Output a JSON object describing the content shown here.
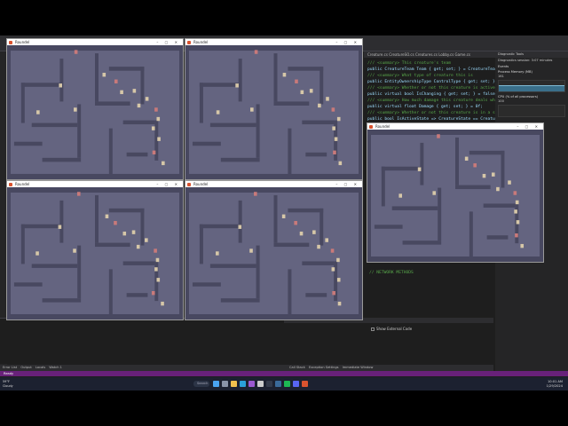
{
  "ide": {
    "tab_label": "Creature.cs  CreatureSO.cs  Creatures.cs  Lobby.cs  Game.cs",
    "code_lines": [
      {
        "text": "/// <summary> This creature's team",
        "type": "comment"
      },
      {
        "text": "public CreatureTeam Team { get; set; } = CreatureTeam.Neutral;",
        "type": "code"
      },
      {
        "text": "/// <summary> What type of creature this is",
        "type": "comment"
      },
      {
        "text": "public EntityOwnershipType ControlType { get; set; } = EntityO",
        "type": "code"
      },
      {
        "text": "/// <summary> Whether or not this creature is actively deali",
        "type": "comment"
      },
      {
        "text": "public virtual bool IsChanging { get; set; } = false;",
        "type": "code"
      },
      {
        "text": "/// <summary> How much damage this creature deals when attac",
        "type": "comment"
      },
      {
        "text": "public virtual float Damage { get; set; } = 0f;",
        "type": "code"
      },
      {
        "text": "/// <summary> Whether or not this creature is in a state tha",
        "type": "comment"
      },
      {
        "text": "public bool IsActiveState => CreatureState == CreatureState.",
        "type": "code"
      }
    ],
    "network_comment": "// NETWORK METHODS",
    "show_external_code": "Show External Code",
    "bottom_tabs_left": [
      "Error List",
      "Output",
      "Locals",
      "Watch 1"
    ],
    "bottom_tabs_right": [
      "Call Stack",
      "Exception Settings",
      "Immediate Window"
    ],
    "status_text": "Ready"
  },
  "diagnostics": {
    "title": "Diagnostic Tools",
    "session": "Diagnostics session: 3:07 minutes",
    "events_label": "Events",
    "memory_label": "Process Memory (MB)",
    "memory_value": "161",
    "cpu_label": "CPU (% of all processors)",
    "cpu_value": "100"
  },
  "game_windows": [
    {
      "title": "Roundel",
      "id": "1"
    },
    {
      "title": "Roundel",
      "id": "2"
    },
    {
      "title": "Roundel",
      "id": "3"
    },
    {
      "title": "Roundel",
      "id": "4"
    },
    {
      "title": "Roundel",
      "id": "5"
    }
  ],
  "taskbar": {
    "weather_temp": "59°F",
    "weather_desc": "Cloudy",
    "search_label": "Search",
    "time": "10:01 AM",
    "date": "1/29/2024",
    "app_icons": [
      {
        "name": "start-icon",
        "color": "#4aa3f0"
      },
      {
        "name": "task-view-icon",
        "color": "#8a94a8"
      },
      {
        "name": "file-explorer-icon",
        "color": "#f2c14e"
      },
      {
        "name": "edge-icon",
        "color": "#2aa0d8"
      },
      {
        "name": "visual-studio-icon",
        "color": "#9b59d0"
      },
      {
        "name": "unity-icon",
        "color": "#cccccc"
      },
      {
        "name": "terminal-icon",
        "color": "#333a4a"
      },
      {
        "name": "steam-icon",
        "color": "#3a6a9a"
      },
      {
        "name": "spotify-icon",
        "color": "#1db954"
      },
      {
        "name": "discord-icon",
        "color": "#5865f2"
      },
      {
        "name": "game-app-icon",
        "color": "#d9532f"
      }
    ]
  },
  "colors": {
    "game_floor": "#646480",
    "game_wall": "#484860",
    "ide_bg": "#1e1e1e",
    "status_bar": "#68217a"
  }
}
